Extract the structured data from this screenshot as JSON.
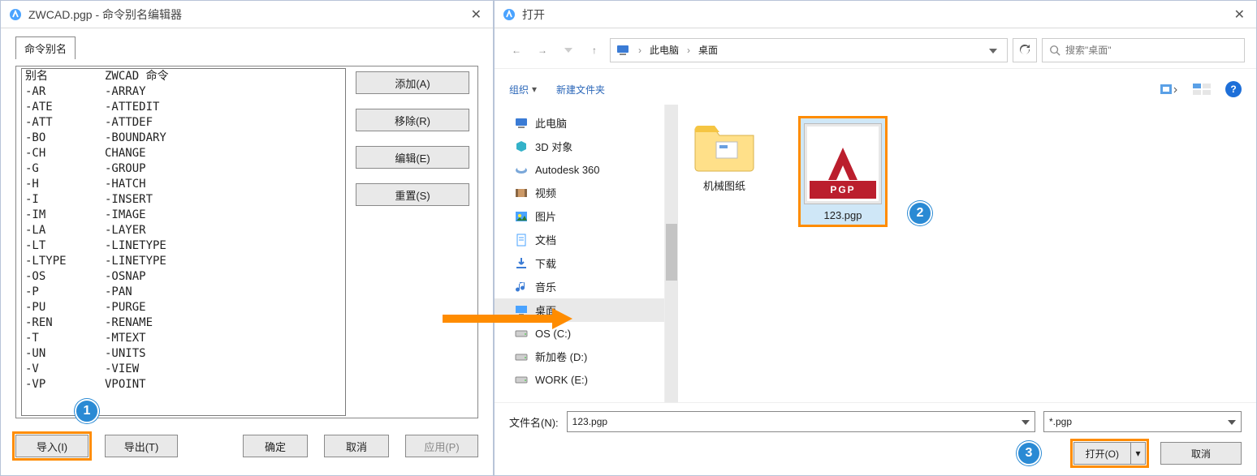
{
  "left_dialog": {
    "title": "ZWCAD.pgp - 命令别名编辑器",
    "tab_label": "命令别名",
    "header_alias": "别名",
    "header_cmd": "ZWCAD 命令",
    "rows": [
      {
        "a": "-AR",
        "b": "-ARRAY"
      },
      {
        "a": "-ATE",
        "b": "-ATTEDIT"
      },
      {
        "a": "-ATT",
        "b": "-ATTDEF"
      },
      {
        "a": "-BO",
        "b": "-BOUNDARY"
      },
      {
        "a": "-CH",
        "b": "CHANGE"
      },
      {
        "a": "-G",
        "b": "-GROUP"
      },
      {
        "a": "-H",
        "b": "-HATCH"
      },
      {
        "a": "-I",
        "b": "-INSERT"
      },
      {
        "a": "-IM",
        "b": "-IMAGE"
      },
      {
        "a": "-LA",
        "b": "-LAYER"
      },
      {
        "a": "-LT",
        "b": "-LINETYPE"
      },
      {
        "a": "-LTYPE",
        "b": "-LINETYPE"
      },
      {
        "a": "-OS",
        "b": "-OSNAP"
      },
      {
        "a": "-P",
        "b": "-PAN"
      },
      {
        "a": "-PU",
        "b": "-PURGE"
      },
      {
        "a": "-REN",
        "b": "-RENAME"
      },
      {
        "a": "-T",
        "b": "-MTEXT"
      },
      {
        "a": "-UN",
        "b": "-UNITS"
      },
      {
        "a": "-V",
        "b": "-VIEW"
      },
      {
        "a": "-VP",
        "b": "VPOINT"
      }
    ],
    "btns": {
      "add": "添加(A)",
      "remove": "移除(R)",
      "edit": "编辑(E)",
      "reset": "重置(S)"
    },
    "footer": {
      "import": "导入(I)",
      "export": "导出(T)",
      "ok": "确定",
      "cancel": "取消",
      "apply": "应用(P)"
    }
  },
  "right_dialog": {
    "title": "打开",
    "crumbs": {
      "root": "此电脑",
      "folder": "桌面"
    },
    "search_placeholder": "搜索\"桌面\"",
    "toolbar": {
      "organize": "组织",
      "new_folder": "新建文件夹"
    },
    "nav": [
      {
        "label": "此电脑",
        "icon": "pc"
      },
      {
        "label": "3D 对象",
        "icon": "3d"
      },
      {
        "label": "Autodesk 360",
        "icon": "a360"
      },
      {
        "label": "视频",
        "icon": "video"
      },
      {
        "label": "图片",
        "icon": "pic"
      },
      {
        "label": "文档",
        "icon": "doc"
      },
      {
        "label": "下载",
        "icon": "dl"
      },
      {
        "label": "音乐",
        "icon": "music"
      },
      {
        "label": "桌面",
        "icon": "desk",
        "selected": true
      },
      {
        "label": "OS (C:)",
        "icon": "drive"
      },
      {
        "label": "新加卷 (D:)",
        "icon": "drive"
      },
      {
        "label": "WORK (E:)",
        "icon": "drive"
      }
    ],
    "files": {
      "folder1": "机械图纸",
      "file1": "123.pgp",
      "file1_band": "PGP"
    },
    "fn_label": "文件名(N):",
    "fn_value": "123.pgp",
    "filter_value": "*.pgp",
    "open_label": "打开(O)",
    "cancel_label": "取消"
  },
  "callouts": {
    "1": "1",
    "2": "2",
    "3": "3"
  }
}
